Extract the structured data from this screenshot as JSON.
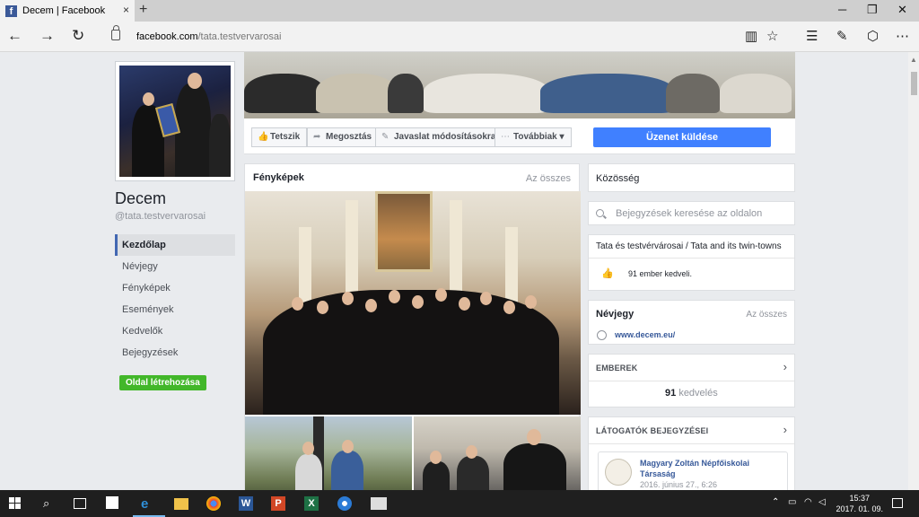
{
  "browser": {
    "tab_title": "Decem | Facebook",
    "tab_close": "×",
    "new_tab": "+",
    "url_domain": "facebook.com",
    "url_path": "/tata.testvervarosai"
  },
  "left": {
    "page_name": "Decem",
    "handle": "@tata.testvervarosai",
    "nav": [
      "Kezdőlap",
      "Névjegy",
      "Fényképek",
      "Események",
      "Kedvelők",
      "Bejegyzések"
    ],
    "create_page": "Oldal létrehozása"
  },
  "actions": {
    "like": "Tetszik",
    "share": "Megosztás",
    "suggest": "Javaslat módosításokra",
    "more": "Továbbiak",
    "send_message": "Üzenet küldése"
  },
  "photos": {
    "title": "Fényképek",
    "see_all": "Az összes"
  },
  "right": {
    "community": "Közösség",
    "search_placeholder": "Bejegyzések keresése az oldalon",
    "page_desc": "Tata és testvérvárosai / Tata and its twin-towns",
    "likes_text": "91 ember kedveli.",
    "about_title": "Névjegy",
    "about_see_all": "Az összes",
    "website": "www.decem.eu/",
    "people_caption": "EMBEREK",
    "people_count": "91",
    "people_label": "kedvelés",
    "visitors_caption": "LÁTOGATÓK BEJEGYZÉSEI",
    "visitor_name": "Magyary Zoltán Népfőiskolai Társaság",
    "visitor_date": "2016. június 27., 6:26"
  },
  "taskbar": {
    "time": "15:37",
    "date": "2017. 01. 09."
  },
  "colors": {
    "fb_blue": "#4267b2",
    "send_blue": "#4080ff",
    "green": "#42b72a"
  }
}
